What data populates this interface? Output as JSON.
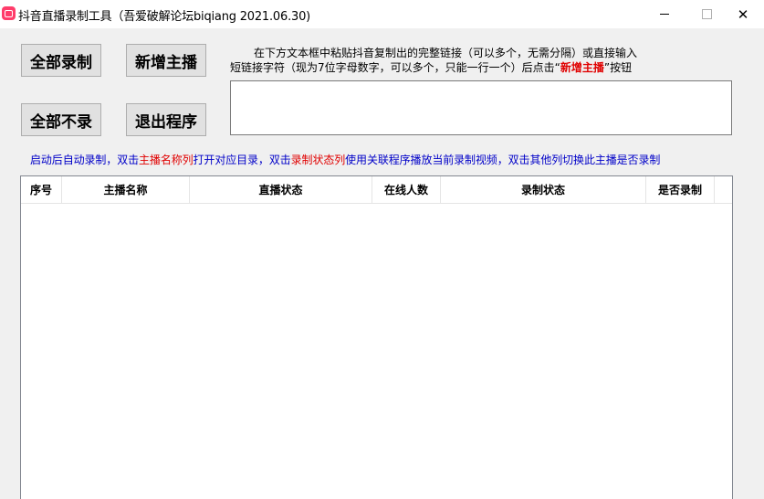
{
  "window": {
    "title": "抖音直播录制工具（吾爱破解论坛biqiang 2021.06.30)",
    "controls": {
      "minimize": "",
      "maximize": "",
      "close": "✕"
    }
  },
  "buttons": {
    "record_all": "全部录制",
    "add_anchor": "新增主播",
    "record_none": "全部不录",
    "exit_program": "退出程序"
  },
  "instructions": {
    "line1": "在下方文本框中粘贴抖音复制出的完整链接（可以多个，无需分隔）或直接输入",
    "line2_before": "短链接字符（现为7位字母数字，可以多个，只能一行一个）后点击“",
    "line2_highlight": "新增主播",
    "line2_after": "”按钮"
  },
  "link_input": {
    "value": ""
  },
  "hint": {
    "part1": "启动后自动录制，双击",
    "part2": "主播名称列",
    "part3": "打开对应目录，双击",
    "part4": "录制状态列",
    "part5": "使用关联程序播放当前录制视频，双击其他列切换此主播是否录制"
  },
  "table": {
    "columns": [
      "序号",
      "主播名称",
      "直播状态",
      "在线人数",
      "录制状态",
      "是否录制"
    ],
    "rows": []
  },
  "colors": {
    "accent_red": "#e00000",
    "hint_blue": "#0000c8",
    "app_icon": "#ff3d6b"
  }
}
